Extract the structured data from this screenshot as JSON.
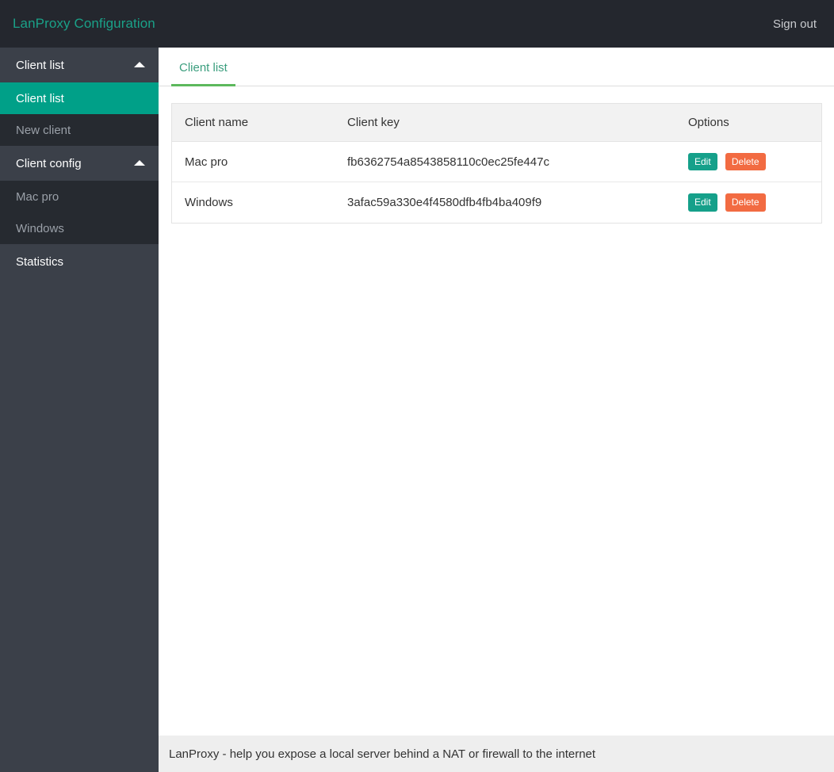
{
  "header": {
    "brand": "LanProxy Configuration",
    "signout_label": "Sign out"
  },
  "sidebar": {
    "groups": [
      {
        "label": "Client list",
        "icon": "caret-up-icon",
        "items": [
          {
            "label": "Client list",
            "active": true
          },
          {
            "label": "New client",
            "active": false
          }
        ]
      },
      {
        "label": "Client config",
        "icon": "caret-up-icon",
        "items": [
          {
            "label": "Mac pro",
            "active": false
          },
          {
            "label": "Windows",
            "active": false
          }
        ]
      }
    ],
    "standalone": [
      {
        "label": "Statistics"
      }
    ]
  },
  "tabs": [
    {
      "label": "Client list",
      "active": true
    }
  ],
  "table": {
    "columns": [
      "Client name",
      "Client key",
      "Options"
    ],
    "rows": [
      {
        "name": "Mac pro",
        "key": "fb6362754a8543858110c0ec25fe447c",
        "edit_label": "Edit",
        "delete_label": "Delete"
      },
      {
        "name": "Windows",
        "key": "3afac59a330e4f4580dfb4fb4ba409f9",
        "edit_label": "Edit",
        "delete_label": "Delete"
      }
    ]
  },
  "footer": {
    "text": "LanProxy - help you expose a local server behind a NAT or firewall to the internet"
  },
  "colors": {
    "brand_teal": "#1aa188",
    "header_bg": "#24272e",
    "sidebar_bg": "#3b4049",
    "sidebar_sub_bg": "#262a30",
    "active_teal": "#00a088",
    "tab_underline": "#5cb85c",
    "btn_edit": "#15a08a",
    "btn_delete": "#f26b42",
    "footer_bg": "#eeeeee"
  }
}
